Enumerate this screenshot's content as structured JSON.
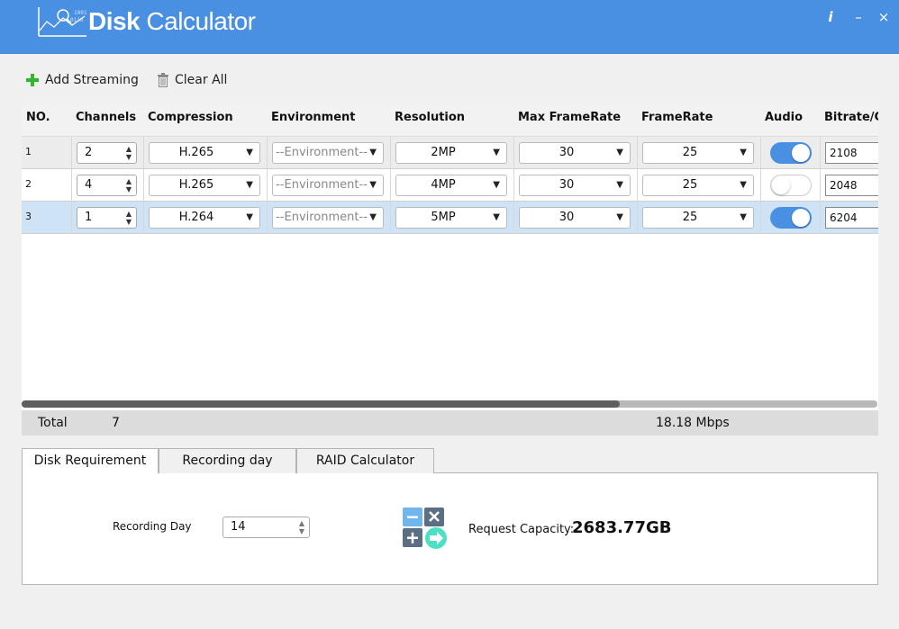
{
  "app": {
    "title_bold": "Disk",
    "title_rest": " Calculator"
  },
  "window": {
    "info_icon": "i",
    "minimize_icon": "–",
    "close_icon": "×"
  },
  "toolbar": {
    "add_label": "Add Streaming",
    "clear_label": "Clear All"
  },
  "grid": {
    "headers": [
      "NO.",
      "Channels",
      "Compression",
      "Environment",
      "Resolution",
      "Max FrameRate",
      "FrameRate",
      "Audio",
      "Bitrate/Ch"
    ],
    "rows": [
      {
        "no": "1",
        "channels": "2",
        "compression": "H.265",
        "environment": "--Environment--",
        "resolution": "2MP",
        "max_framerate": "30",
        "framerate": "25",
        "audio": true,
        "bitrate": "2108"
      },
      {
        "no": "2",
        "channels": "4",
        "compression": "H.265",
        "environment": "--Environment--",
        "resolution": "4MP",
        "max_framerate": "30",
        "framerate": "25",
        "audio": false,
        "bitrate": "2048"
      },
      {
        "no": "3",
        "channels": "1",
        "compression": "H.264",
        "environment": "--Environment--",
        "resolution": "5MP",
        "max_framerate": "30",
        "framerate": "25",
        "audio": true,
        "bitrate": "6204"
      }
    ]
  },
  "total": {
    "label": "Total",
    "channels": "7",
    "bandwidth": "18.18 Mbps"
  },
  "tabs": [
    "Disk Requirement",
    "Recording day",
    "RAID Calculator"
  ],
  "disk": {
    "recording_day_label": "Recording Day",
    "recording_day_value": "14",
    "request_label": "Request Capacity:",
    "request_value": "2683.77GB"
  },
  "colors": {
    "accent": "#4a90e2",
    "selected_row": "#cfe3f7",
    "add_green": "#2db82d"
  }
}
